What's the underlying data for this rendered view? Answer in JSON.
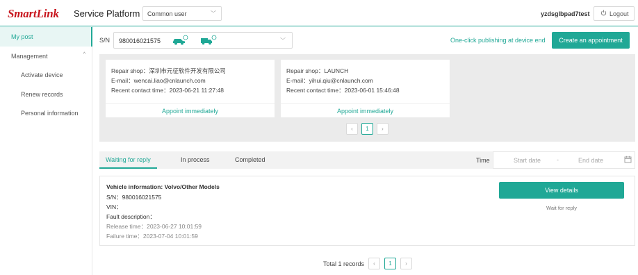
{
  "header": {
    "logo": "SmartLink",
    "platform": "Service Platform |",
    "role_select": "Common user",
    "username": "yzdsglbpad7test",
    "logout": "Logout"
  },
  "sidebar": {
    "items": [
      {
        "label": "My post",
        "active": true
      },
      {
        "label": "Management",
        "group": true
      },
      {
        "label": "Activate device"
      },
      {
        "label": "Renew records"
      },
      {
        "label": "Personal information"
      }
    ]
  },
  "sn_bar": {
    "label": "S/N",
    "value": "980016021575",
    "one_click": "One-click publishing at device end",
    "create_button": "Create an appointment"
  },
  "shops": [
    {
      "repair_shop": "Repair shop：深圳市元征软件开发有限公司",
      "email": "E-mail：wencai.liao@cnlaunch.com",
      "recent_contact": "Recent contact time：2023-06-21 11:27:48",
      "action": "Appoint immediately"
    },
    {
      "repair_shop": "Repair shop：LAUNCH",
      "email": "E-mail：yihui.qiu@cnlaunch.com",
      "recent_contact": "Recent contact time：2023-06-01 15:46:48",
      "action": "Appoint immediately"
    }
  ],
  "shop_pager": {
    "prev": "‹",
    "current": "1",
    "next": "›"
  },
  "tabs": [
    {
      "label": "Waiting for reply",
      "active": true
    },
    {
      "label": "In process"
    },
    {
      "label": "Completed"
    }
  ],
  "filter": {
    "time_label": "Time",
    "start_placeholder": "Start date",
    "separator": "-",
    "end_placeholder": "End date"
  },
  "post": {
    "vehicle_label": "Vehicle information:",
    "vehicle_value": "Volvo/Other Models",
    "sn": "S/N：980016021575",
    "vin": "VIN：",
    "fault": "Fault description：",
    "release": "Release time：2023-06-27 10:01:59",
    "failure": "Failure time：2023-07-04 10:01:59",
    "details_button": "View details",
    "status": "Wait for reply"
  },
  "pagination": {
    "total": "Total 1 records",
    "prev": "‹",
    "current": "1",
    "next": "›"
  },
  "colors": {
    "accent": "#20a896",
    "brand": "#c8161e"
  }
}
